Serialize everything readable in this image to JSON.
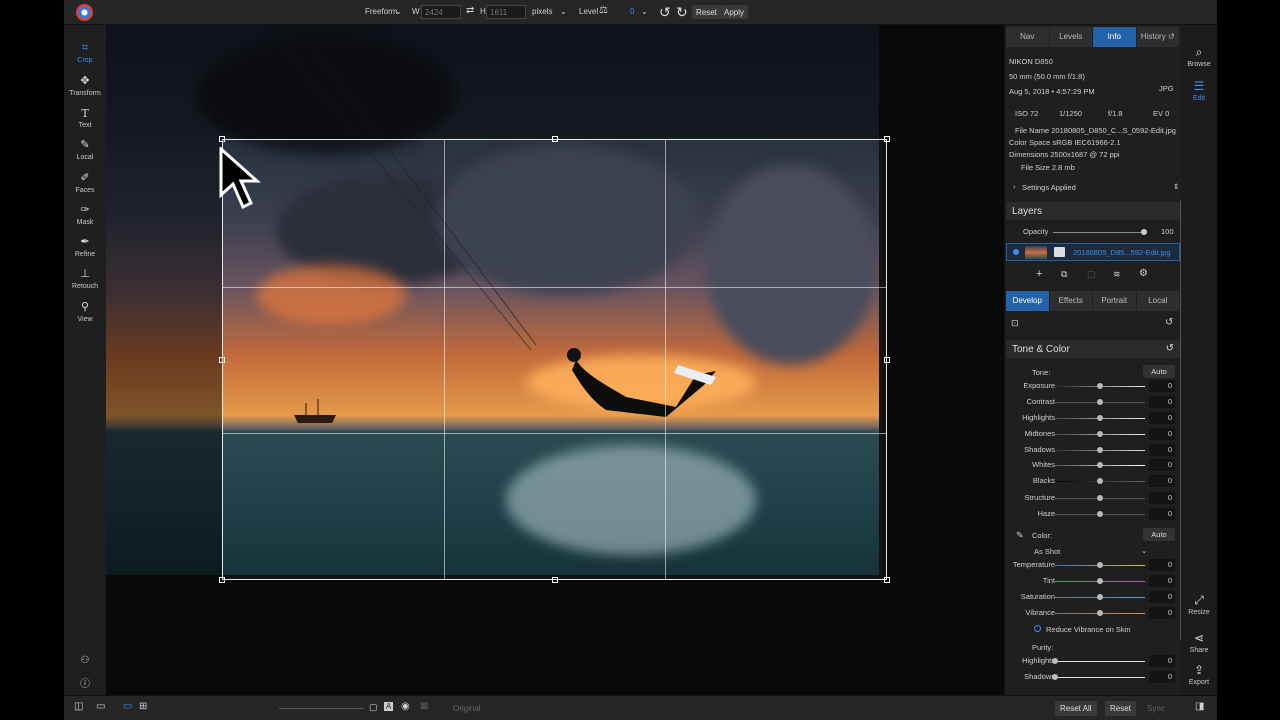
{
  "topbar": {
    "mode_label": "Freeform",
    "width_label": "W",
    "width_value": "2424",
    "height_label": "H",
    "height_value": "1611",
    "units": "pixels",
    "level_label": "Level",
    "level_value": "0",
    "reset_label": "Reset",
    "apply_label": "Apply"
  },
  "tools": [
    {
      "label": "Crop",
      "icon": "crop-icon"
    },
    {
      "label": "Transform",
      "icon": "transform-icon"
    },
    {
      "label": "Text",
      "icon": "text-icon"
    },
    {
      "label": "Local",
      "icon": "brush-icon"
    },
    {
      "label": "Faces",
      "icon": "faces-icon"
    },
    {
      "label": "Mask",
      "icon": "mask-icon"
    },
    {
      "label": "Refine",
      "icon": "refine-icon"
    },
    {
      "label": "Retouch",
      "icon": "retouch-icon"
    },
    {
      "label": "View",
      "icon": "view-icon"
    }
  ],
  "panel_tabs": [
    "Nav",
    "Levels",
    "Info",
    "History"
  ],
  "info": {
    "camera": "NIKON D850",
    "lens": "50 mm (50.0 mm f/1.8)",
    "date": "Aug 5, 2018 • 4:57:29 PM",
    "format": "JPG",
    "iso": "ISO 72",
    "shutter": "1/1250",
    "aperture": "f/1.8",
    "ev": "EV 0",
    "file_name": "File Name 20180805_D850_C...S_0592-Edit.jpg",
    "color_space": "Color Space sRGB IEC61966-2.1",
    "dimensions": "Dimensions 2500x1687 @ 72 ppi",
    "file_size": "File Size 2.8 mb",
    "settings_applied": "Settings Applied"
  },
  "layers": {
    "title": "Layers",
    "opacity_label": "Opacity",
    "opacity_value": "100",
    "layer_name": "20180805_D85...592-Edit.jpg"
  },
  "develop_tabs": [
    "Develop",
    "Effects",
    "Portrait",
    "Local"
  ],
  "tone_color": {
    "title": "Tone & Color",
    "tone_label": "Tone:",
    "auto_label": "Auto",
    "sliders": [
      {
        "label": "Exposure",
        "value": "0"
      },
      {
        "label": "Contrast",
        "value": "0"
      },
      {
        "label": "Highlights",
        "value": "0"
      },
      {
        "label": "Midtones",
        "value": "0"
      },
      {
        "label": "Shadows",
        "value": "0"
      },
      {
        "label": "Whites",
        "value": "0"
      },
      {
        "label": "Blacks",
        "value": "0"
      },
      {
        "label": "Structure",
        "value": "0"
      },
      {
        "label": "Haze",
        "value": "0"
      }
    ],
    "color_label": "Color:",
    "color_auto": "Auto",
    "white_balance": "As Shot",
    "color_sliders": [
      {
        "label": "Temperature",
        "value": "0"
      },
      {
        "label": "Tint",
        "value": "0"
      },
      {
        "label": "Saturation",
        "value": "0"
      },
      {
        "label": "Vibrance",
        "value": "0"
      }
    ],
    "reduce_vibrance": "Reduce Vibrance on Skin",
    "purity_label": "Purity:",
    "purity_sliders": [
      {
        "label": "Highlights",
        "value": "0"
      },
      {
        "label": "Shadows",
        "value": "0"
      }
    ]
  },
  "farbar": [
    {
      "label": "Browse",
      "icon": "browse-icon"
    },
    {
      "label": "Edit",
      "icon": "edit-icon"
    },
    {
      "label": "Resize",
      "icon": "resize-icon"
    },
    {
      "label": "Share",
      "icon": "share-icon"
    },
    {
      "label": "Export",
      "icon": "export-icon"
    }
  ],
  "bottombar": {
    "original_label": "Original",
    "reset_all_label": "Reset All",
    "reset_label": "Reset",
    "sync_label": "Sync"
  },
  "colors": {
    "accent": "#2361a8",
    "accent_text": "#3d8ef0",
    "background": "#1f1f1f"
  }
}
